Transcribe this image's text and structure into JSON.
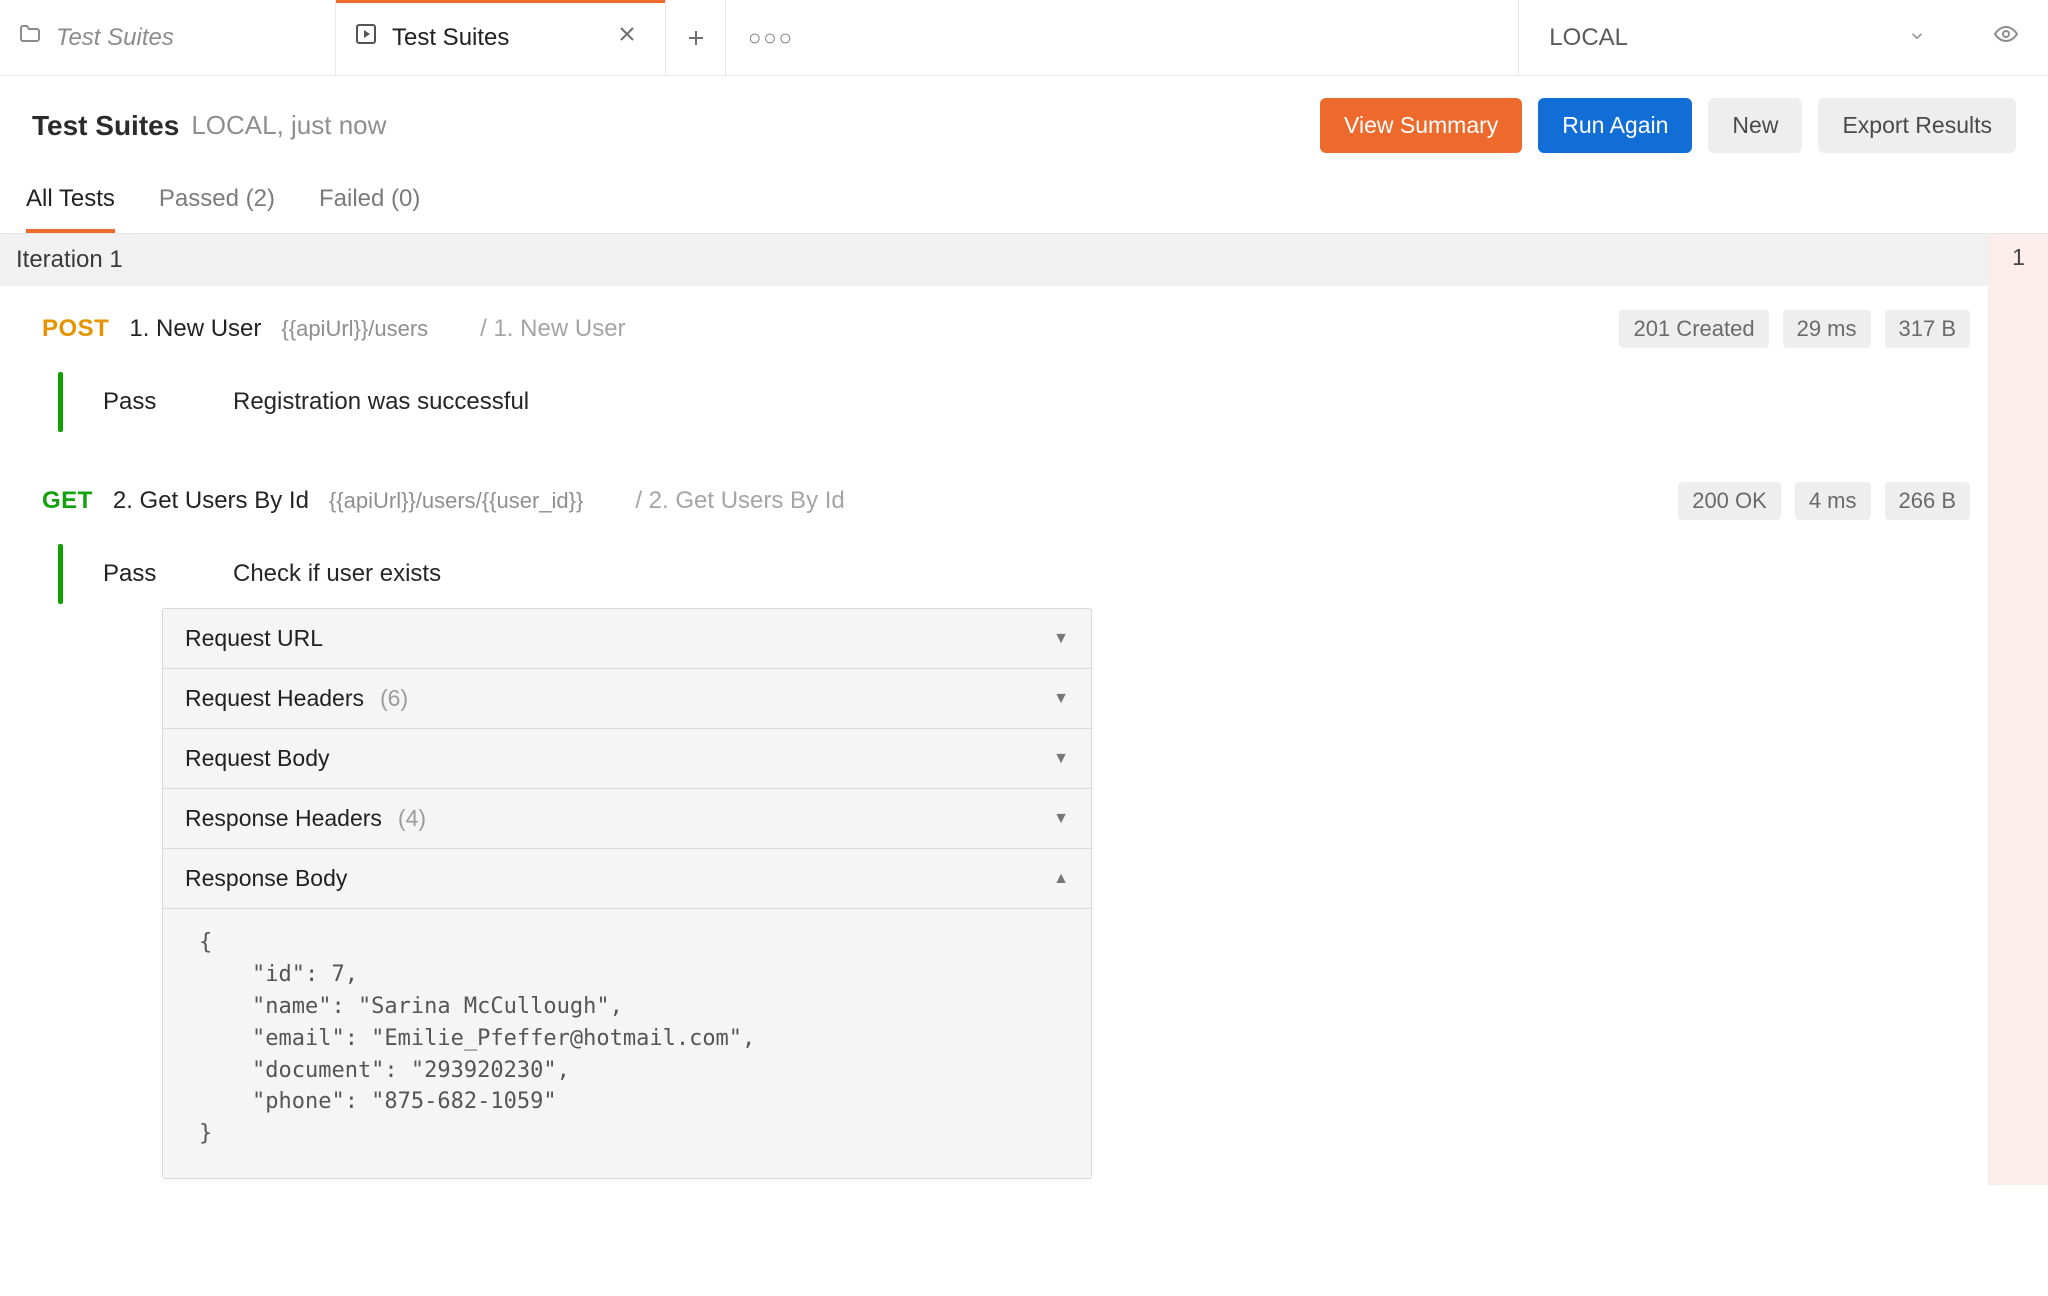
{
  "tabs": {
    "parent_label": "Test Suites",
    "active_label": "Test Suites"
  },
  "env": {
    "name": "LOCAL"
  },
  "header": {
    "title": "Test Suites",
    "subtitle": "LOCAL, just now"
  },
  "buttons": {
    "view_summary": "View Summary",
    "run_again": "Run Again",
    "new": "New",
    "export": "Export Results"
  },
  "filters": {
    "all": "All Tests",
    "passed": "Passed (2)",
    "failed": "Failed (0)"
  },
  "iteration": {
    "label": "Iteration 1",
    "side_count": "1"
  },
  "requests": [
    {
      "method": "POST",
      "name": "1. New User",
      "url": "{{apiUrl}}/users",
      "crumb": "/ 1. New User",
      "status": "201 Created",
      "time": "29 ms",
      "size": "317 B",
      "test_pass": "Pass",
      "test_desc": "Registration was successful"
    },
    {
      "method": "GET",
      "name": "2. Get Users By Id",
      "url": "{{apiUrl}}/users/{{user_id}}",
      "crumb": "/ 2. Get Users By Id",
      "status": "200 OK",
      "time": "4 ms",
      "size": "266 B",
      "test_pass": "Pass",
      "test_desc": "Check if user exists"
    }
  ],
  "details": {
    "request_url": "Request URL",
    "request_headers": "Request Headers",
    "request_headers_count": "(6)",
    "request_body": "Request Body",
    "response_headers": "Response Headers",
    "response_headers_count": "(4)",
    "response_body": "Response Body",
    "response_body_content": "{\n    \"id\": 7,\n    \"name\": \"Sarina McCullough\",\n    \"email\": \"Emilie_Pfeffer@hotmail.com\",\n    \"document\": \"293920230\",\n    \"phone\": \"875-682-1059\"\n}"
  }
}
